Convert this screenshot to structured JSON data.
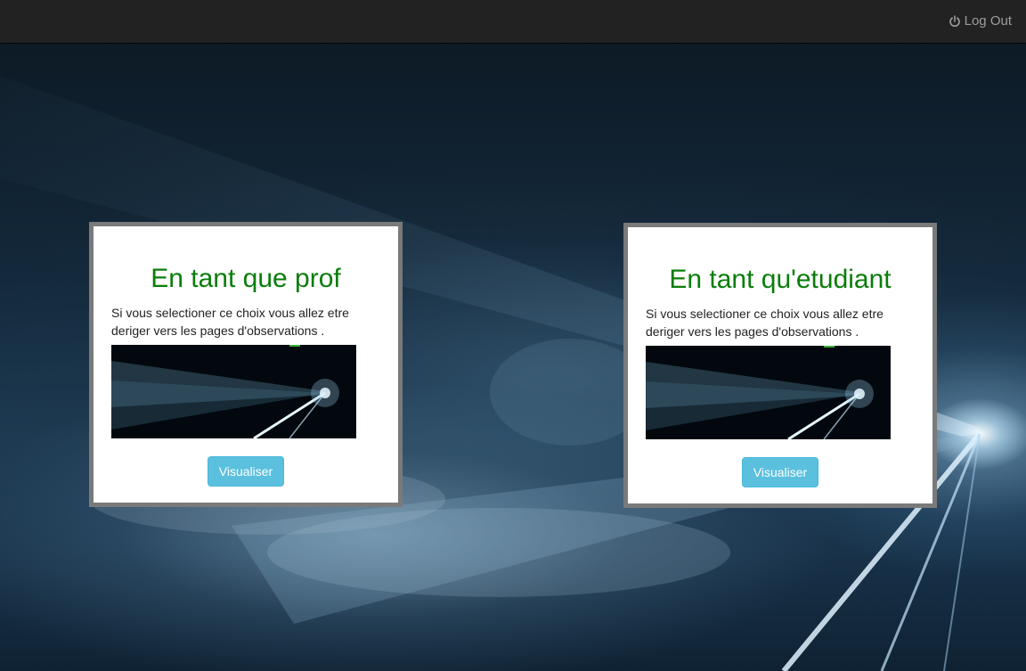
{
  "navbar": {
    "logout_label": "Log Out",
    "logout_icon": "power-icon"
  },
  "cards": [
    {
      "title": "En tant que prof",
      "description": "Si vous selectioner ce choix vous allez etre deriger vers les pages d'observations .",
      "button_label": "Visualiser"
    },
    {
      "title": "En tant qu'etudiant",
      "description": "Si vous selectioner ce choix vous allez etre deriger vers les pages d'observations .",
      "button_label": "Visualiser"
    }
  ],
  "colors": {
    "navbar_bg": "#222222",
    "title_green": "#0a7d0a",
    "button_info": "#5bc0de",
    "card_border": "#7a7a7a"
  }
}
